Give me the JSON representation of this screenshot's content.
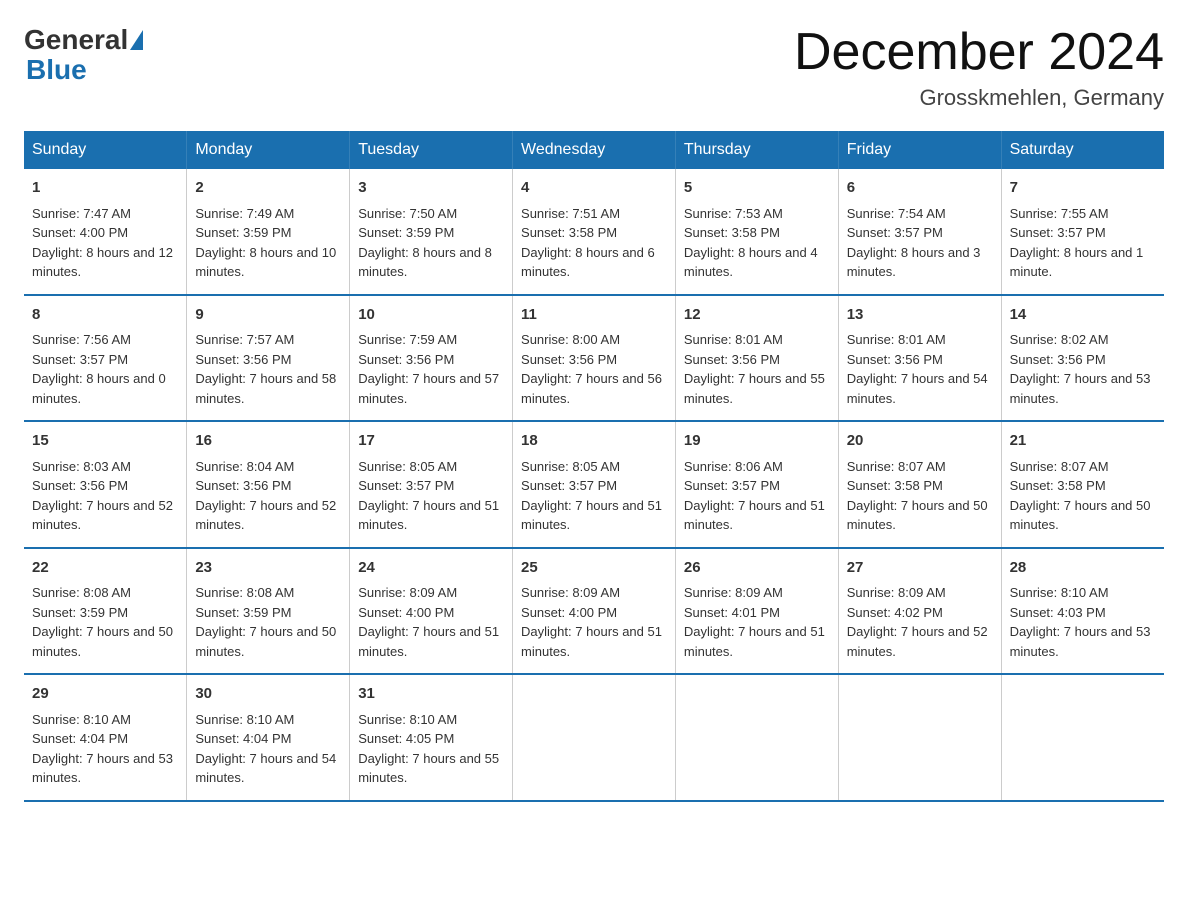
{
  "header": {
    "logo": {
      "general": "General",
      "blue": "Blue"
    },
    "title": "December 2024",
    "location": "Grosskmehlen, Germany"
  },
  "weekdays": [
    "Sunday",
    "Monday",
    "Tuesday",
    "Wednesday",
    "Thursday",
    "Friday",
    "Saturday"
  ],
  "weeks": [
    [
      {
        "day": "1",
        "sunrise": "7:47 AM",
        "sunset": "4:00 PM",
        "daylight": "8 hours and 12 minutes."
      },
      {
        "day": "2",
        "sunrise": "7:49 AM",
        "sunset": "3:59 PM",
        "daylight": "8 hours and 10 minutes."
      },
      {
        "day": "3",
        "sunrise": "7:50 AM",
        "sunset": "3:59 PM",
        "daylight": "8 hours and 8 minutes."
      },
      {
        "day": "4",
        "sunrise": "7:51 AM",
        "sunset": "3:58 PM",
        "daylight": "8 hours and 6 minutes."
      },
      {
        "day": "5",
        "sunrise": "7:53 AM",
        "sunset": "3:58 PM",
        "daylight": "8 hours and 4 minutes."
      },
      {
        "day": "6",
        "sunrise": "7:54 AM",
        "sunset": "3:57 PM",
        "daylight": "8 hours and 3 minutes."
      },
      {
        "day": "7",
        "sunrise": "7:55 AM",
        "sunset": "3:57 PM",
        "daylight": "8 hours and 1 minute."
      }
    ],
    [
      {
        "day": "8",
        "sunrise": "7:56 AM",
        "sunset": "3:57 PM",
        "daylight": "8 hours and 0 minutes."
      },
      {
        "day": "9",
        "sunrise": "7:57 AM",
        "sunset": "3:56 PM",
        "daylight": "7 hours and 58 minutes."
      },
      {
        "day": "10",
        "sunrise": "7:59 AM",
        "sunset": "3:56 PM",
        "daylight": "7 hours and 57 minutes."
      },
      {
        "day": "11",
        "sunrise": "8:00 AM",
        "sunset": "3:56 PM",
        "daylight": "7 hours and 56 minutes."
      },
      {
        "day": "12",
        "sunrise": "8:01 AM",
        "sunset": "3:56 PM",
        "daylight": "7 hours and 55 minutes."
      },
      {
        "day": "13",
        "sunrise": "8:01 AM",
        "sunset": "3:56 PM",
        "daylight": "7 hours and 54 minutes."
      },
      {
        "day": "14",
        "sunrise": "8:02 AM",
        "sunset": "3:56 PM",
        "daylight": "7 hours and 53 minutes."
      }
    ],
    [
      {
        "day": "15",
        "sunrise": "8:03 AM",
        "sunset": "3:56 PM",
        "daylight": "7 hours and 52 minutes."
      },
      {
        "day": "16",
        "sunrise": "8:04 AM",
        "sunset": "3:56 PM",
        "daylight": "7 hours and 52 minutes."
      },
      {
        "day": "17",
        "sunrise": "8:05 AM",
        "sunset": "3:57 PM",
        "daylight": "7 hours and 51 minutes."
      },
      {
        "day": "18",
        "sunrise": "8:05 AM",
        "sunset": "3:57 PM",
        "daylight": "7 hours and 51 minutes."
      },
      {
        "day": "19",
        "sunrise": "8:06 AM",
        "sunset": "3:57 PM",
        "daylight": "7 hours and 51 minutes."
      },
      {
        "day": "20",
        "sunrise": "8:07 AM",
        "sunset": "3:58 PM",
        "daylight": "7 hours and 50 minutes."
      },
      {
        "day": "21",
        "sunrise": "8:07 AM",
        "sunset": "3:58 PM",
        "daylight": "7 hours and 50 minutes."
      }
    ],
    [
      {
        "day": "22",
        "sunrise": "8:08 AM",
        "sunset": "3:59 PM",
        "daylight": "7 hours and 50 minutes."
      },
      {
        "day": "23",
        "sunrise": "8:08 AM",
        "sunset": "3:59 PM",
        "daylight": "7 hours and 50 minutes."
      },
      {
        "day": "24",
        "sunrise": "8:09 AM",
        "sunset": "4:00 PM",
        "daylight": "7 hours and 51 minutes."
      },
      {
        "day": "25",
        "sunrise": "8:09 AM",
        "sunset": "4:00 PM",
        "daylight": "7 hours and 51 minutes."
      },
      {
        "day": "26",
        "sunrise": "8:09 AM",
        "sunset": "4:01 PM",
        "daylight": "7 hours and 51 minutes."
      },
      {
        "day": "27",
        "sunrise": "8:09 AM",
        "sunset": "4:02 PM",
        "daylight": "7 hours and 52 minutes."
      },
      {
        "day": "28",
        "sunrise": "8:10 AM",
        "sunset": "4:03 PM",
        "daylight": "7 hours and 53 minutes."
      }
    ],
    [
      {
        "day": "29",
        "sunrise": "8:10 AM",
        "sunset": "4:04 PM",
        "daylight": "7 hours and 53 minutes."
      },
      {
        "day": "30",
        "sunrise": "8:10 AM",
        "sunset": "4:04 PM",
        "daylight": "7 hours and 54 minutes."
      },
      {
        "day": "31",
        "sunrise": "8:10 AM",
        "sunset": "4:05 PM",
        "daylight": "7 hours and 55 minutes."
      },
      {
        "day": "",
        "sunrise": "",
        "sunset": "",
        "daylight": ""
      },
      {
        "day": "",
        "sunrise": "",
        "sunset": "",
        "daylight": ""
      },
      {
        "day": "",
        "sunrise": "",
        "sunset": "",
        "daylight": ""
      },
      {
        "day": "",
        "sunrise": "",
        "sunset": "",
        "daylight": ""
      }
    ]
  ],
  "labels": {
    "sunrise": "Sunrise:",
    "sunset": "Sunset:",
    "daylight": "Daylight:"
  }
}
